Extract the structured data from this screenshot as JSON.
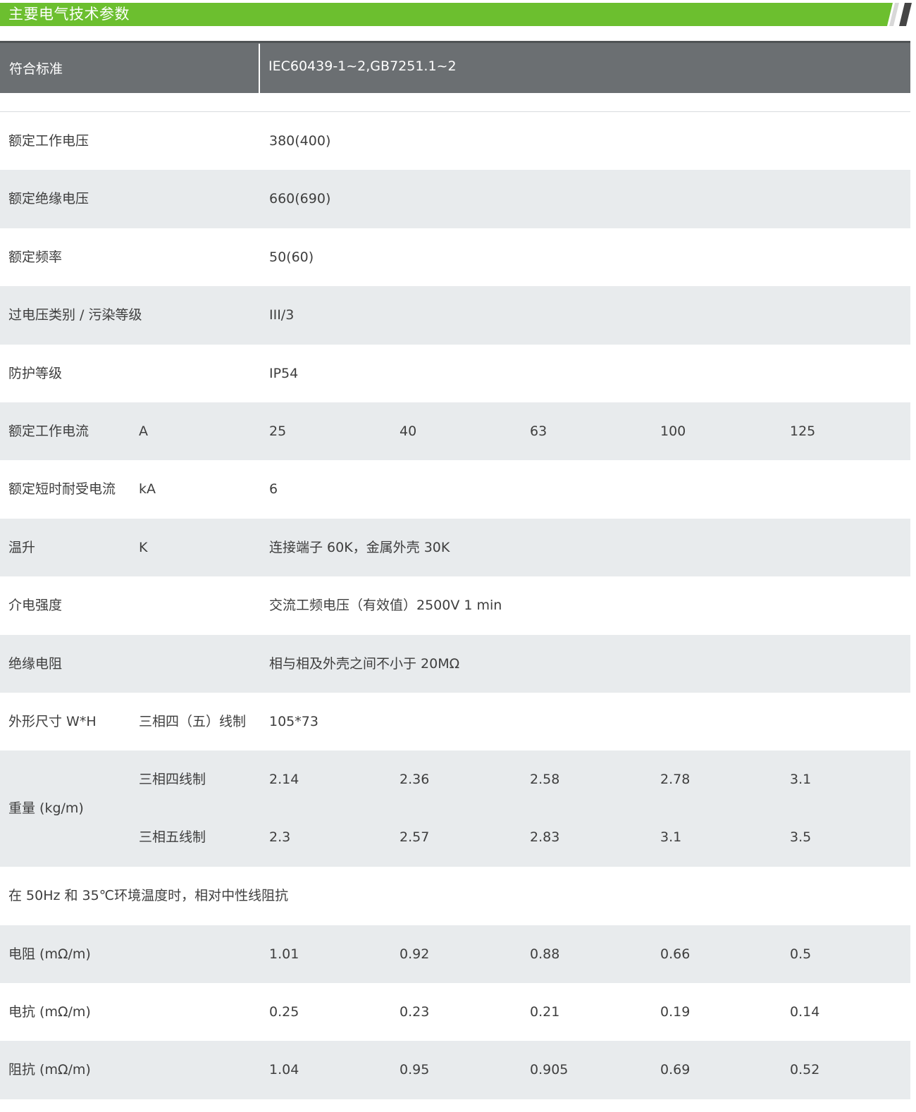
{
  "section_title": "主要电气技术参数",
  "header": {
    "label": "符合标准",
    "value": "IEC60439-1~2,GB7251.1~2"
  },
  "rows": {
    "rated_voltage": {
      "label": "额定工作电压",
      "value": "380(400)"
    },
    "insulation_voltage": {
      "label": "额定绝缘电压",
      "value": "660(690)"
    },
    "frequency": {
      "label": "额定频率",
      "value": "50(60)"
    },
    "overvoltage": {
      "label": "过电压类别 / 污染等级",
      "value": "III/3"
    },
    "protection": {
      "label": "防护等级",
      "value": "IP54"
    },
    "rated_current": {
      "label": "额定工作电流",
      "unit": "A",
      "values": [
        "25",
        "40",
        "63",
        "100",
        "125"
      ]
    },
    "short_time": {
      "label": "额定短时耐受电流",
      "unit": "kA",
      "value": "6"
    },
    "temp_rise": {
      "label": "温升",
      "unit": "K",
      "value": "连接端子 60K，金属外壳 30K"
    },
    "dielectric": {
      "label": "介电强度",
      "value": "交流工频电压（有效值）2500V 1 min"
    },
    "insulation_resistance": {
      "label": "绝缘电阻",
      "value": "相与相及外壳之间不小于 20MΩ"
    },
    "dimensions": {
      "label": "外形尺寸 W*H",
      "unit": "三相四（五）线制",
      "value": "105*73"
    },
    "weight": {
      "label": "重量 (kg/m)",
      "four_wire": {
        "unit": "三相四线制",
        "values": [
          "2.14",
          "2.36",
          "2.58",
          "2.78",
          "3.1"
        ]
      },
      "five_wire": {
        "unit": "三相五线制",
        "values": [
          "2.3",
          "2.57",
          "2.83",
          "3.1",
          "3.5"
        ]
      }
    },
    "note": "在 50Hz 和 35℃环境温度时，相对中性线阻抗",
    "resistance": {
      "label": "电阻 (mΩ/m)",
      "values": [
        "1.01",
        "0.92",
        "0.88",
        "0.66",
        "0.5"
      ]
    },
    "reactance": {
      "label": "电抗 (mΩ/m)",
      "values": [
        "0.25",
        "0.23",
        "0.21",
        "0.19",
        "0.14"
      ]
    },
    "impedance": {
      "label": "阻抗 (mΩ/m)",
      "values": [
        "1.04",
        "0.95",
        "0.905",
        "0.69",
        "0.52"
      ]
    }
  },
  "colors": {
    "accent_green": "#6cbf2f",
    "header_gray": "#6b6f72",
    "row_shade": "#e8ebed"
  }
}
